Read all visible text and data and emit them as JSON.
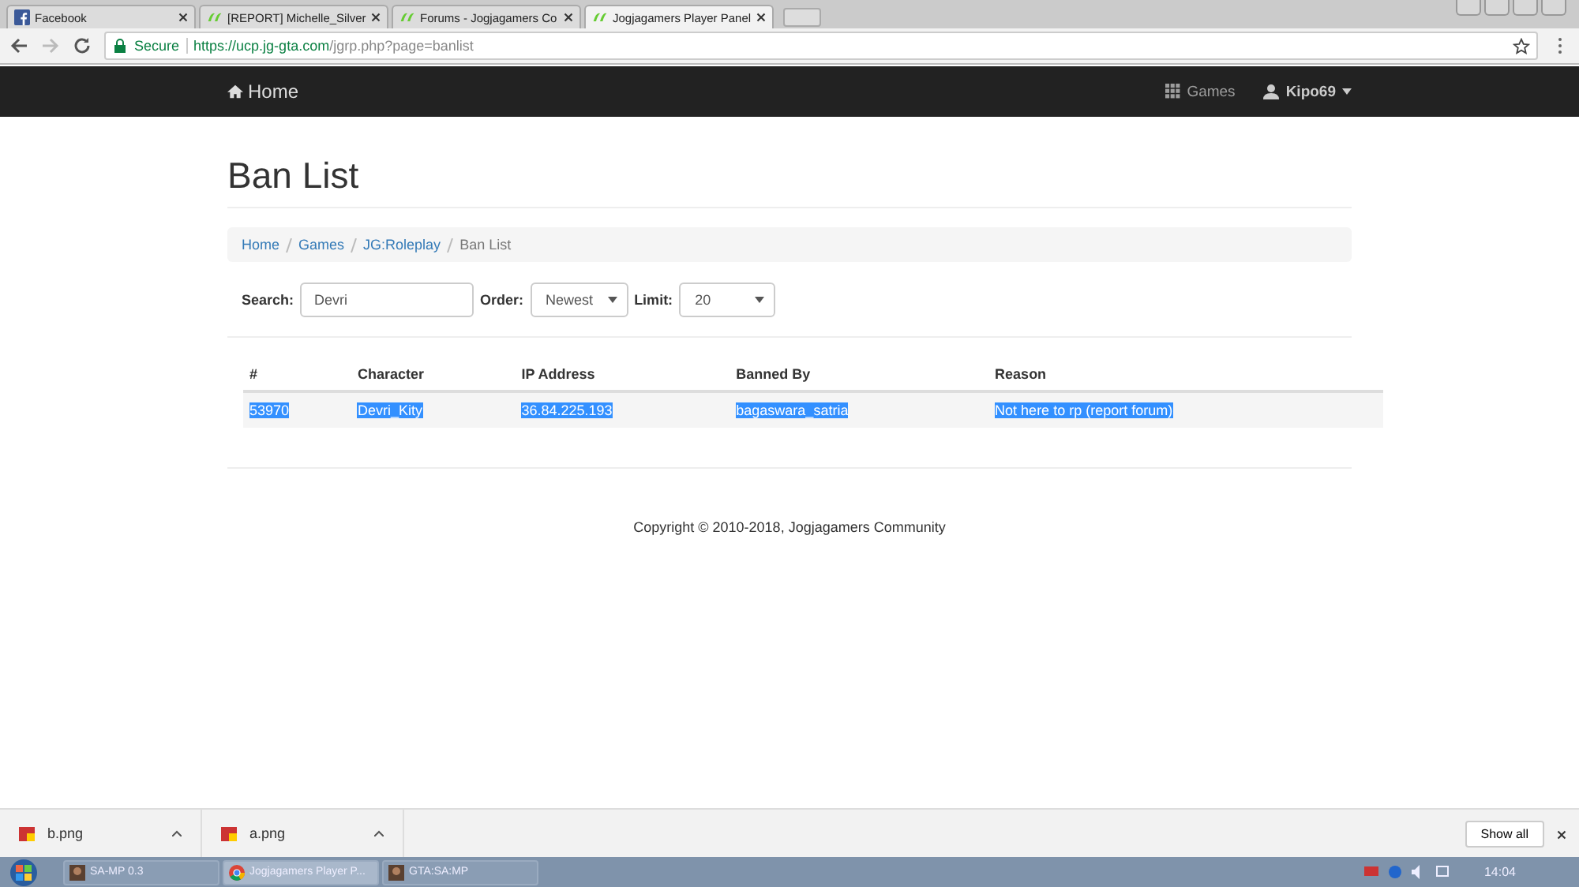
{
  "browser_tabs": [
    {
      "title": "Facebook",
      "kind": "facebook",
      "selected": false
    },
    {
      "title": "[REPORT] Michelle_Silver",
      "kind": "forum",
      "selected": false
    },
    {
      "title": "Forums - Jogjagamers Co",
      "kind": "forum",
      "selected": false
    },
    {
      "title": "Jogjagamers Player Panel",
      "kind": "forum",
      "selected": true
    }
  ],
  "address_bar": {
    "secure_label": "Secure",
    "url_host": "https://ucp.jg-gta.com",
    "url_path": "/jgrp.php?page=banlist"
  },
  "navbar": {
    "brand": "Home",
    "games": "Games",
    "user": "Kipo69"
  },
  "page_title": "Ban List",
  "breadcrumb": [
    {
      "label": "Home",
      "link": true
    },
    {
      "label": "Games",
      "link": true
    },
    {
      "label": "JG:Roleplay",
      "link": true
    },
    {
      "label": "Ban List",
      "link": false
    }
  ],
  "filters": {
    "search_label": "Search:",
    "search_value": "Devri",
    "order_label": "Order:",
    "order_value": "Newest",
    "limit_label": "Limit:",
    "limit_value": "20"
  },
  "table": {
    "columns": [
      "#",
      "Character",
      "IP Address",
      "Banned By",
      "Reason"
    ],
    "rows": [
      {
        "cells": [
          "53970",
          "Devri_Kity",
          "36.84.225.193",
          "bagaswara_satria",
          "Not here to rp (report forum)"
        ],
        "highlighted": true
      }
    ]
  },
  "footer": "Copyright © 2010-2018, Jogjagamers Community",
  "downloads": [
    {
      "name": "b.png"
    },
    {
      "name": "a.png"
    }
  ],
  "download_bar_button": "Show all",
  "taskbar": {
    "items": [
      {
        "label": "SA-MP 0.3",
        "kind": "game",
        "selected": false
      },
      {
        "label": "Jogjagamers Player P...",
        "kind": "browser",
        "selected": true
      },
      {
        "label": "GTA:SA:MP",
        "kind": "game",
        "selected": false
      }
    ],
    "clock": "14:04"
  }
}
